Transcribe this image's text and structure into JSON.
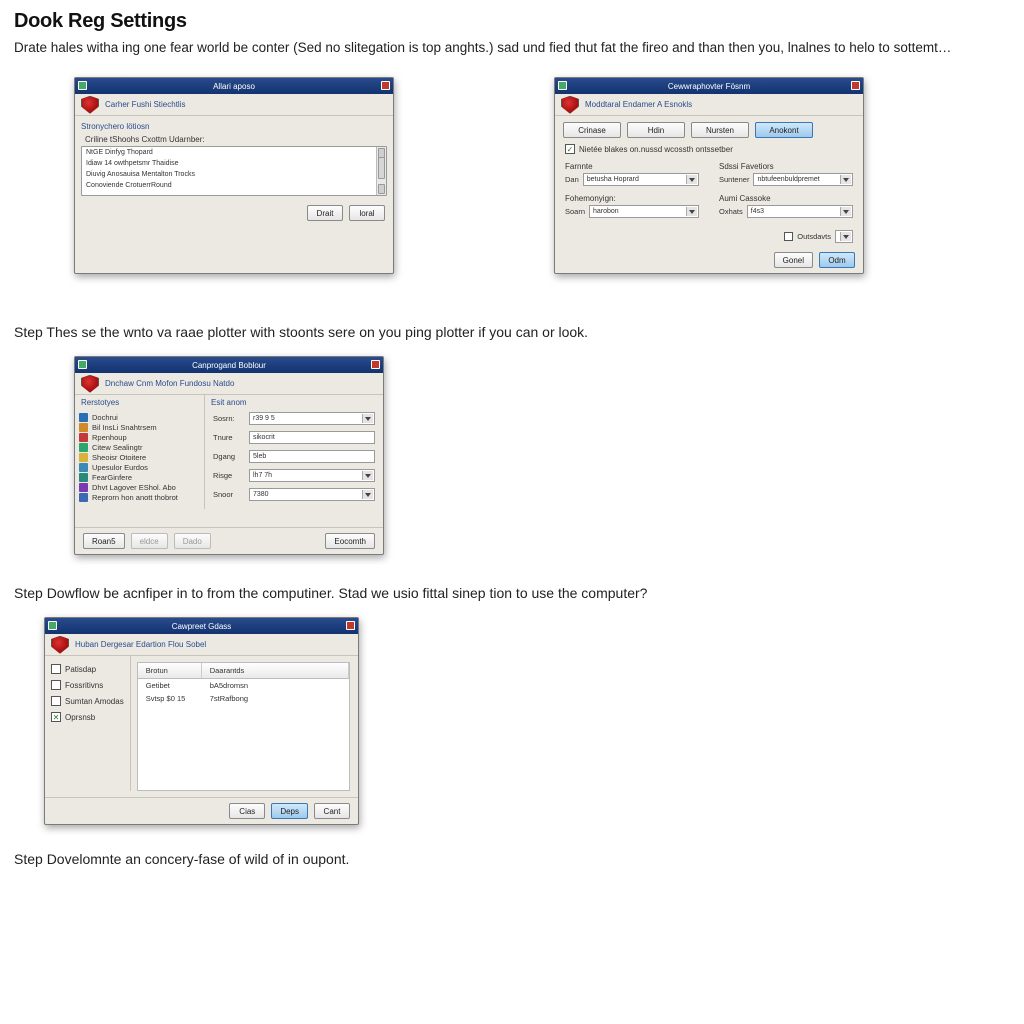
{
  "page": {
    "title": "Dook Reg Settings",
    "intro": "Drate hales witha ing one fear world be conter (Sed no slitegation is top anghts.) sad und fied thut fat the fireo and than then you, lnalnes to helo to sottemt…",
    "step2": "Step Thes se the wnto va raae plotter with stoonts sere on you ping plotter if you can or look.",
    "step3": "Step Dowflow be acnfiper in to from the computiner.  Stad we usio fittal sinep tion to use the computer?",
    "step4": "Step Dovelomnte an concery-fase of wild of in oupont."
  },
  "win1": {
    "title": "Allari aposo",
    "subtitle": "Carher Fushi Stiechtlis",
    "group": "Stronychero lötiosn",
    "label": "Criline tShoohs Cxottm Udarnber:",
    "items": [
      "NtGE Dinfyg Thopard",
      "Idiaw 14 owthpetsmr Thaidise",
      "Diuvig Anosauisa Mentalton Trocks",
      "Conoviende CrotuerrRound"
    ],
    "btn_left": "Drait",
    "btn_right": "loral"
  },
  "win2": {
    "title": "Cewwraphovter Fösnm",
    "subtitle": "Moddtaral Endamer A Esnokls",
    "tabs": [
      "Crinase",
      "Hdin",
      "Nursten",
      "Anokont"
    ],
    "checkbox": "Nietée blakes on.nussd wcossth ontssetber",
    "left_head": "Farnnte",
    "right_head": "Sdssi Favetiors",
    "left_label1": "Dan",
    "left_val1": "betusha Hoprard",
    "right_label1": "Suntener",
    "right_val1": "nbtufeenbuldpremet",
    "section2l": "Fohemonyign:",
    "section2r": "Aumi Cassoke",
    "left_label2": "Soarn",
    "left_val2": "harobon",
    "right_label2": "Oxhats",
    "right_val2": "f4s3",
    "opt_check": "Outsdavts",
    "btn_cancel": "Gonel",
    "btn_ok": "Odm"
  },
  "win3": {
    "title": "Canprogand Boblour",
    "subtitle": "Dnchaw Cnm Mofon Fundosu Natdo",
    "left_head": "Rerstotyes",
    "right_head": "Esit anom",
    "sidebar": [
      {
        "label": "Dochrui",
        "color": "#2a6fb5"
      },
      {
        "label": "Bil InsLi Snahtrsem",
        "color": "#d08a2a"
      },
      {
        "label": "Rpenhoup",
        "color": "#c23a3a"
      },
      {
        "label": "Citew Sealingtr",
        "color": "#2aa66f"
      },
      {
        "label": "Sheoisr Otoitere",
        "color": "#d8b23a"
      },
      {
        "label": "Upesulor Eurdos",
        "color": "#3a8ab5"
      },
      {
        "label": "FearGinfere",
        "color": "#2a8a7a"
      },
      {
        "label": "Dhvt Lagover EShol. Abo",
        "color": "#7a3ab5"
      },
      {
        "label": "Reprorn hon anott thobrot",
        "color": "#3a6ab5"
      }
    ],
    "fields": [
      {
        "label": "Sosrn:",
        "value": "r39 9 5",
        "type": "combo"
      },
      {
        "label": "Tnure",
        "value": "sikocrit",
        "type": "text"
      },
      {
        "label": "Dgang",
        "value": "5leb",
        "type": "text"
      },
      {
        "label": "Risge",
        "value": "lh7 7h",
        "type": "combo"
      },
      {
        "label": "Snoor",
        "value": "7380",
        "type": "combo"
      }
    ],
    "btn_back": "Roan5",
    "btn_mid1": "eldce",
    "btn_mid2": "Dado",
    "btn_right": "Eocomth"
  },
  "win4": {
    "title": "Cawpreet Gdass",
    "subtitle": "Huban Dergesar Edartion Flou Sobel",
    "left_tabs": [
      {
        "label": "Patisdap",
        "checked": false
      },
      {
        "label": "Fossritivns",
        "checked": false
      },
      {
        "label": "Sumtan Amodas",
        "checked": false
      },
      {
        "label": "Oprsnsb",
        "checked": true
      }
    ],
    "col1": "Brotun",
    "col2": "Daarantds",
    "rows": [
      {
        "a": "Getibet",
        "b": "bA5dromsn"
      },
      {
        "a": "Svtsp $0 15",
        "b": "7stRafbong"
      }
    ],
    "btn_cancel": "Cias",
    "btn_apply": "Deps",
    "btn_close": "Cant"
  }
}
